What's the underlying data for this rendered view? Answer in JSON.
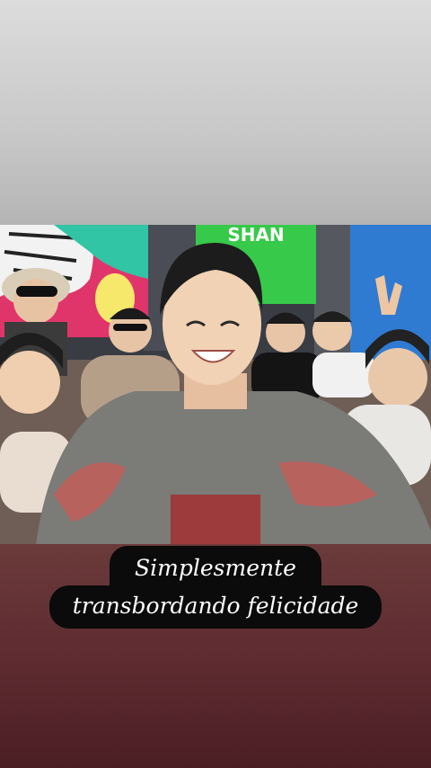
{
  "story": {
    "caption_line1": "Simplesmente",
    "caption_line2": "transbordando felicidade",
    "photo_sign_text": "SHAN"
  },
  "colors": {
    "caption_bg": "#0b0b0b",
    "caption_text": "#ffffff",
    "top_background": "#c8c8c8",
    "bottom_background": "#5e2c31"
  }
}
